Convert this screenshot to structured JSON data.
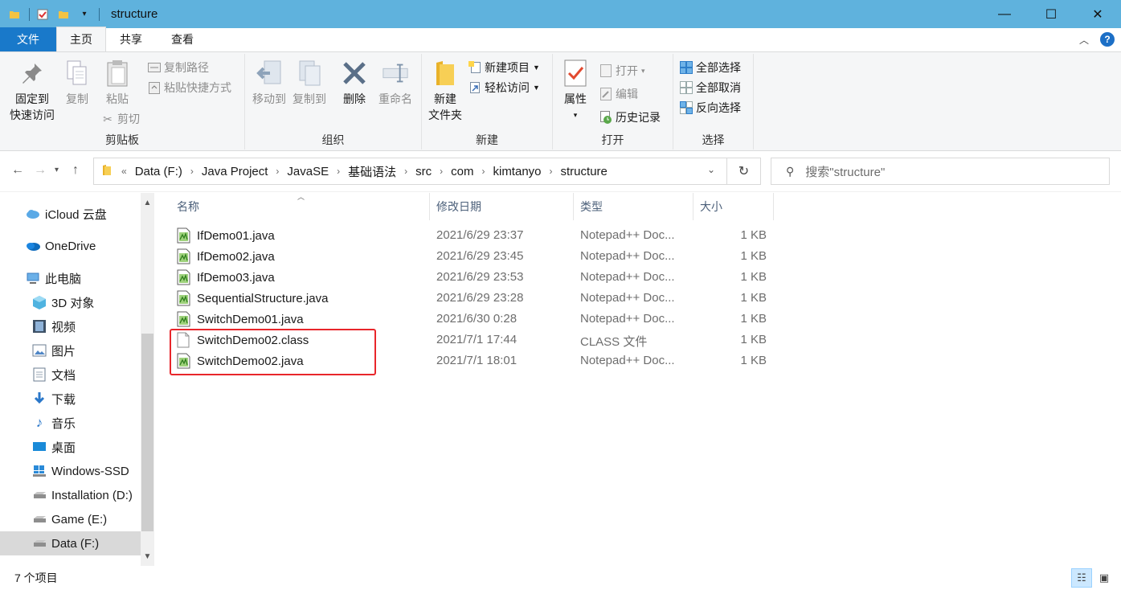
{
  "window": {
    "title": "structure",
    "controls": {
      "minimize": "—",
      "maximize": "☐",
      "close": "✕"
    }
  },
  "ribbon_tabs": {
    "file": "文件",
    "home": "主页",
    "share": "共享",
    "view": "查看"
  },
  "ribbon": {
    "clipboard": {
      "label": "剪贴板",
      "pin": "固定到\n快速访问",
      "pin_l1": "固定到",
      "pin_l2": "快速访问",
      "copy": "复制",
      "paste": "粘贴",
      "copy_path": "复制路径",
      "paste_shortcut": "粘贴快捷方式",
      "cut": "剪切"
    },
    "organize": {
      "label": "组织",
      "move_to": "移动到",
      "copy_to": "复制到",
      "delete": "删除",
      "rename": "重命名"
    },
    "new": {
      "label": "新建",
      "new_folder_l1": "新建",
      "new_folder_l2": "文件夹",
      "new_item": "新建项目",
      "easy_access": "轻松访问"
    },
    "open": {
      "label": "打开",
      "properties": "属性",
      "open": "打开",
      "edit": "编辑",
      "history": "历史记录"
    },
    "select": {
      "label": "选择",
      "select_all": "全部选择",
      "select_none": "全部取消",
      "invert": "反向选择"
    }
  },
  "address": {
    "prefix": "«",
    "crumbs": [
      "Data (F:)",
      "Java Project",
      "JavaSE",
      "基础语法",
      "src",
      "com",
      "kimtanyo",
      "structure"
    ],
    "search_placeholder": "搜索\"structure\""
  },
  "nav_pane": {
    "items": [
      {
        "label": "iCloud 云盘",
        "icon": "icloud-icon"
      },
      {
        "label": "OneDrive",
        "icon": "onedrive-icon"
      },
      {
        "label": "此电脑",
        "icon": "this-pc-icon"
      },
      {
        "label": "3D 对象",
        "icon": "3d-objects-icon"
      },
      {
        "label": "视频",
        "icon": "video-icon"
      },
      {
        "label": "图片",
        "icon": "pictures-icon"
      },
      {
        "label": "文档",
        "icon": "documents-icon"
      },
      {
        "label": "下载",
        "icon": "downloads-icon"
      },
      {
        "label": "音乐",
        "icon": "music-icon"
      },
      {
        "label": "桌面",
        "icon": "desktop-icon"
      },
      {
        "label": "Windows-SSD",
        "icon": "windows-drive-icon"
      },
      {
        "label": "Installation (D:)",
        "icon": "drive-icon"
      },
      {
        "label": "Game (E:)",
        "icon": "drive-icon"
      },
      {
        "label": "Data (F:)",
        "icon": "drive-icon"
      }
    ],
    "selected": "Data (F:)"
  },
  "file_list": {
    "columns": {
      "name": "名称",
      "date": "修改日期",
      "type": "类型",
      "size": "大小"
    },
    "rows": [
      {
        "name": "IfDemo01.java",
        "date": "2021/6/29 23:37",
        "type": "Notepad++ Doc...",
        "size": "1 KB",
        "icon": "notepadpp-file-icon"
      },
      {
        "name": "IfDemo02.java",
        "date": "2021/6/29 23:45",
        "type": "Notepad++ Doc...",
        "size": "1 KB",
        "icon": "notepadpp-file-icon"
      },
      {
        "name": "IfDemo03.java",
        "date": "2021/6/29 23:53",
        "type": "Notepad++ Doc...",
        "size": "1 KB",
        "icon": "notepadpp-file-icon"
      },
      {
        "name": "SequentialStructure.java",
        "date": "2021/6/29 23:28",
        "type": "Notepad++ Doc...",
        "size": "1 KB",
        "icon": "notepadpp-file-icon"
      },
      {
        "name": "SwitchDemo01.java",
        "date": "2021/6/30 0:28",
        "type": "Notepad++ Doc...",
        "size": "1 KB",
        "icon": "notepadpp-file-icon"
      },
      {
        "name": "SwitchDemo02.class",
        "date": "2021/7/1 17:44",
        "type": "CLASS 文件",
        "size": "1 KB",
        "icon": "blank-file-icon"
      },
      {
        "name": "SwitchDemo02.java",
        "date": "2021/7/1 18:01",
        "type": "Notepad++ Doc...",
        "size": "1 KB",
        "icon": "notepadpp-file-icon"
      }
    ]
  },
  "status": {
    "item_count": "7 个项目"
  },
  "colors": {
    "titlebar": "#5fb2dd",
    "file_tab": "#1979ca",
    "highlight_box": "#e8262b"
  }
}
